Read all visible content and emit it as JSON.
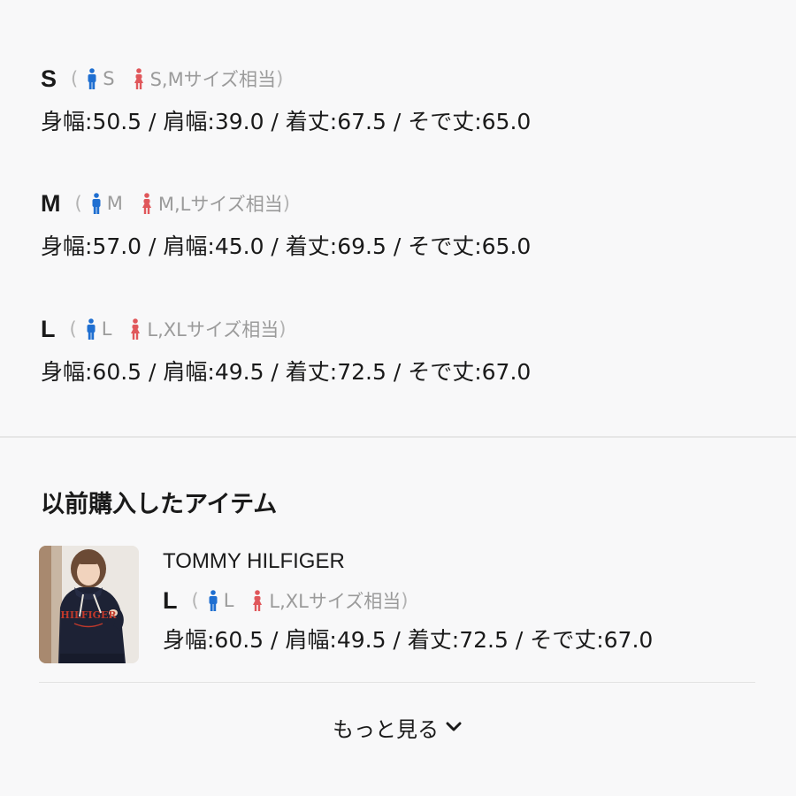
{
  "sizes": [
    {
      "label": "S",
      "paren_open": "(",
      "paren_close": ")",
      "mens": "S",
      "womens": "S,Mサイズ相当",
      "measurements": "身幅:50.5 / 肩幅:39.0 / 着丈:67.5 / そで丈:65.0"
    },
    {
      "label": "M",
      "paren_open": "(",
      "paren_close": ")",
      "mens": "M",
      "womens": "M,Lサイズ相当",
      "measurements": "身幅:57.0 / 肩幅:45.0 / 着丈:69.5 / そで丈:65.0"
    },
    {
      "label": "L",
      "paren_open": "(",
      "paren_close": ")",
      "mens": "L",
      "womens": "L,XLサイズ相当",
      "measurements": "身幅:60.5 / 肩幅:49.5 / 着丈:72.5 / そで丈:67.0"
    }
  ],
  "previous_purchases": {
    "title": "以前購入したアイテム",
    "items": [
      {
        "brand": "TOMMY HILFIGER",
        "size": {
          "label": "L",
          "paren_open": "(",
          "paren_close": ")",
          "mens": "L",
          "womens": "L,XLサイズ相当",
          "measurements": "身幅:60.5 / 肩幅:49.5 / 着丈:72.5 / そで丈:67.0"
        },
        "thumbnail_graphic_text": "HILFIGER"
      }
    ]
  },
  "more_button": {
    "label": "もっと見る",
    "icon": "chevron-down-icon"
  },
  "colors": {
    "mens_icon": "#1f6fd1",
    "womens_icon": "#e0575b",
    "secondary_text": "#9b9b9b",
    "primary_text": "#1a1a1a",
    "background": "#f8f8f9"
  }
}
